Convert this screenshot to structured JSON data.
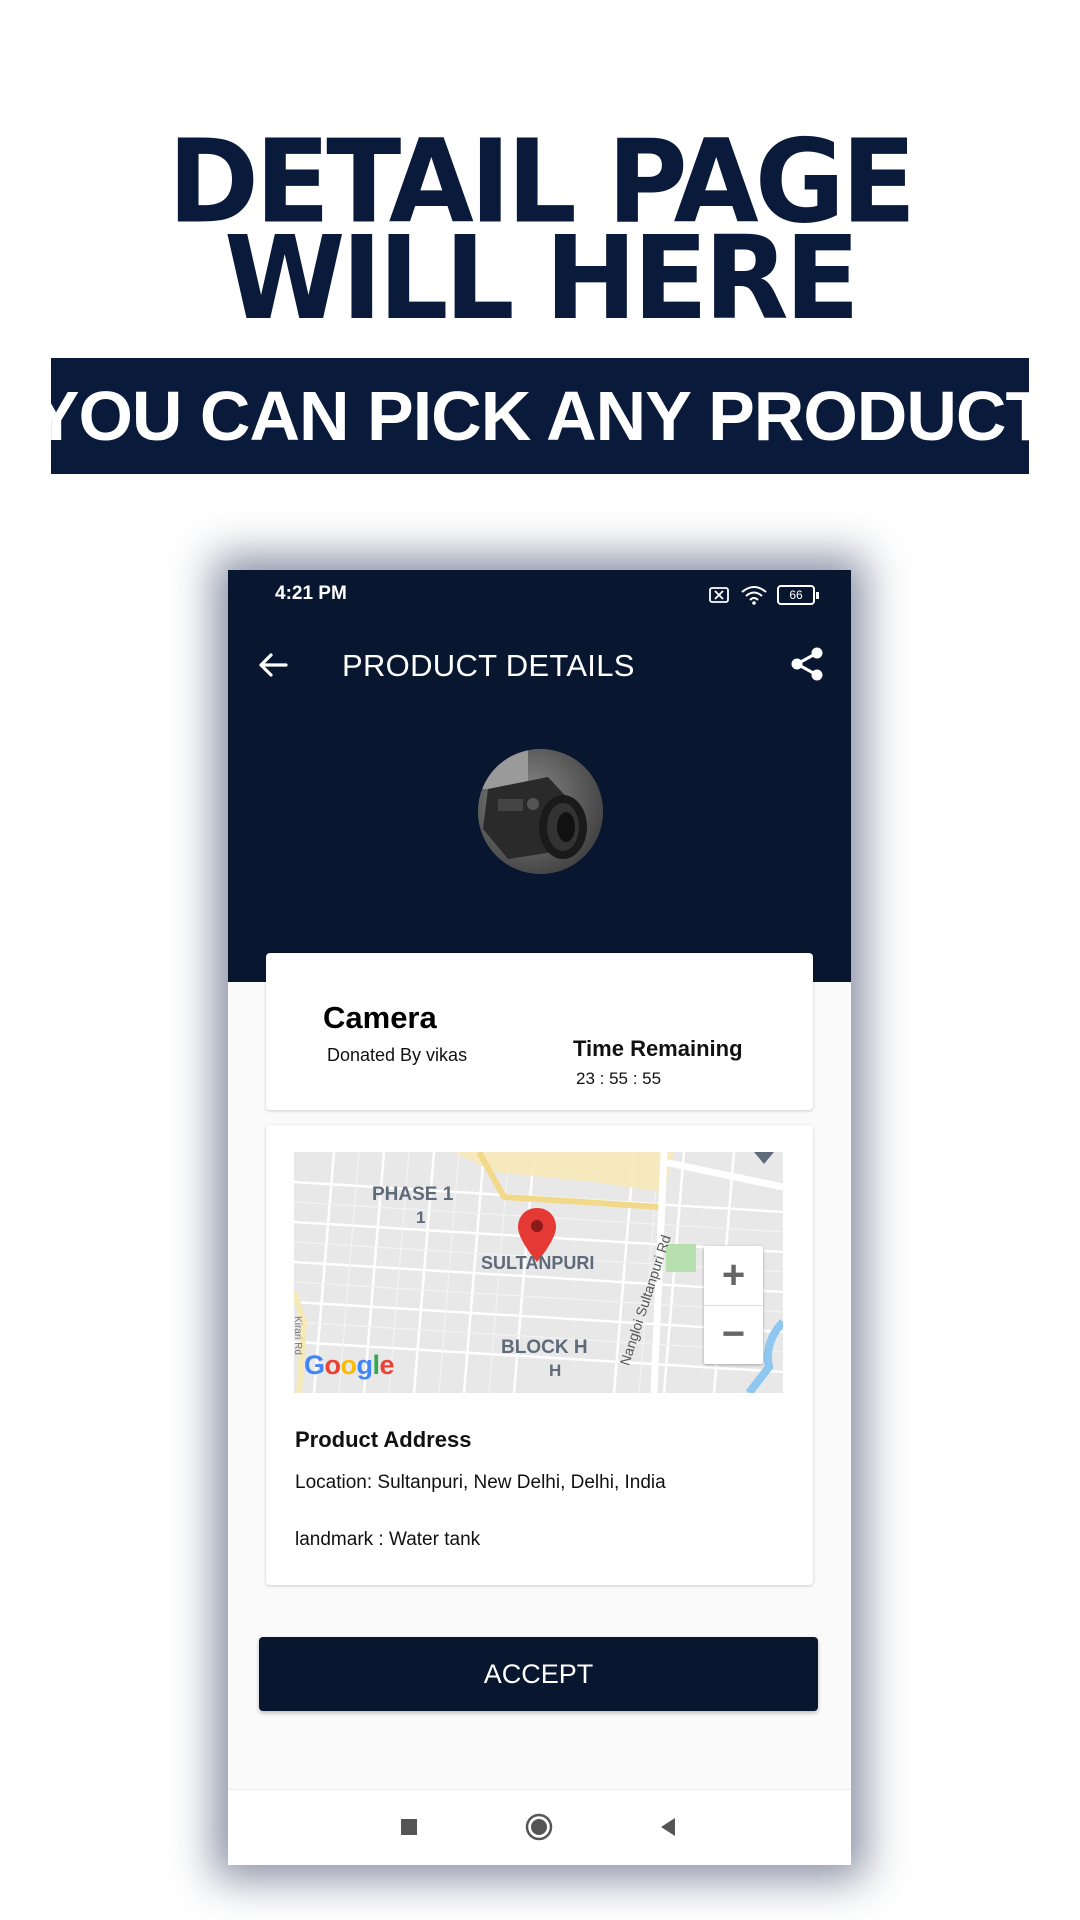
{
  "promo": {
    "headline_line1": "DETAIL PAGE",
    "headline_line2": "WILL HERE",
    "banner": "YOU CAN PICK ANY PRODUCT"
  },
  "status_bar": {
    "time": "4:21 PM",
    "battery": "66",
    "icons": [
      "sim-off-icon",
      "wifi-icon",
      "battery-icon"
    ]
  },
  "header": {
    "title": "PRODUCT DETAILS",
    "back_icon": "arrow-left-icon",
    "share_icon": "share-icon"
  },
  "product": {
    "name": "Camera",
    "donated_by": "Donated By vikas",
    "time_remaining_label": "Time Remaining",
    "time_remaining_value": "23 : 55 : 55"
  },
  "map": {
    "labels": {
      "phase1": "PHASE 1",
      "phase1_sub": "1",
      "sultanpuri": "SULTANPURI",
      "blockh": "BLOCK H",
      "blockh_sub": "H",
      "road": "Nangloi Sultanpuri Rd",
      "road_left": "Kirari Rd"
    },
    "zoom_in": "+",
    "zoom_out": "−",
    "attribution": "Google"
  },
  "address": {
    "title": "Product Address",
    "location": "Location: Sultanpuri, New Delhi, Delhi, India",
    "landmark": "landmark : Water tank"
  },
  "actions": {
    "accept": "ACCEPT"
  },
  "colors": {
    "navy": "#08162f",
    "headline": "#0a1a3a",
    "pin": "#e53935"
  }
}
